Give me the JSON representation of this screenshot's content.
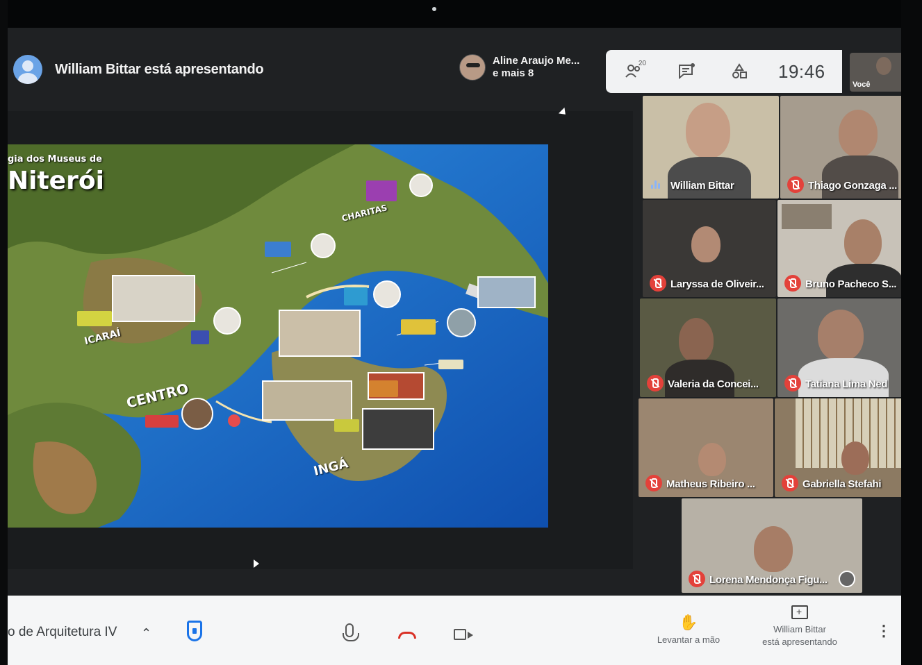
{
  "presenter": {
    "text": "William Bittar está apresentando"
  },
  "participants_chip": {
    "line1": "Aline Araujo Me...",
    "line2": "e mais 8"
  },
  "top_controls": {
    "people_count": "20",
    "time": "19:46",
    "self_label": "Você",
    "more": "..."
  },
  "slide": {
    "title_small": "gia dos Museus de",
    "title": "Niterói",
    "labels": [
      "CENTRO",
      "ICARAÍ",
      "INGÁ",
      "CHARITAS"
    ]
  },
  "tiles": [
    {
      "name": "William Bittar",
      "muted": false
    },
    {
      "name": "Thiago Gonzaga ...",
      "muted": true
    },
    {
      "name": "Laryssa de Oliveir...",
      "muted": true
    },
    {
      "name": "Bruno Pacheco S...",
      "muted": true
    },
    {
      "name": "Valeria da Concei...",
      "muted": true
    },
    {
      "name": "Tatiana Lima Ned",
      "muted": true
    },
    {
      "name": "Matheus Ribeiro ...",
      "muted": true
    },
    {
      "name": "Gabriella Stefahi",
      "muted": true
    },
    {
      "name": "Lorena Mendonça Figu...",
      "muted": true
    }
  ],
  "bottom_bar": {
    "meeting_title": "o de Arquitetura IV",
    "raise_hand_label": "Levantar a mão",
    "present_line1": "William Bittar",
    "present_line2": "está apresentando"
  },
  "colors": {
    "accent": "#1a73e8",
    "muted_red": "#e3413a",
    "hangup_red": "#d93025",
    "toolbar_bg": "#f5f6f7"
  },
  "icons": [
    "people-icon",
    "chat-icon",
    "activities-icon",
    "shield-icon",
    "mic-icon",
    "hangup-icon",
    "camera-icon",
    "hand-icon",
    "present-icon",
    "more-vert-icon",
    "chevron-up-icon",
    "mic-off-icon"
  ]
}
